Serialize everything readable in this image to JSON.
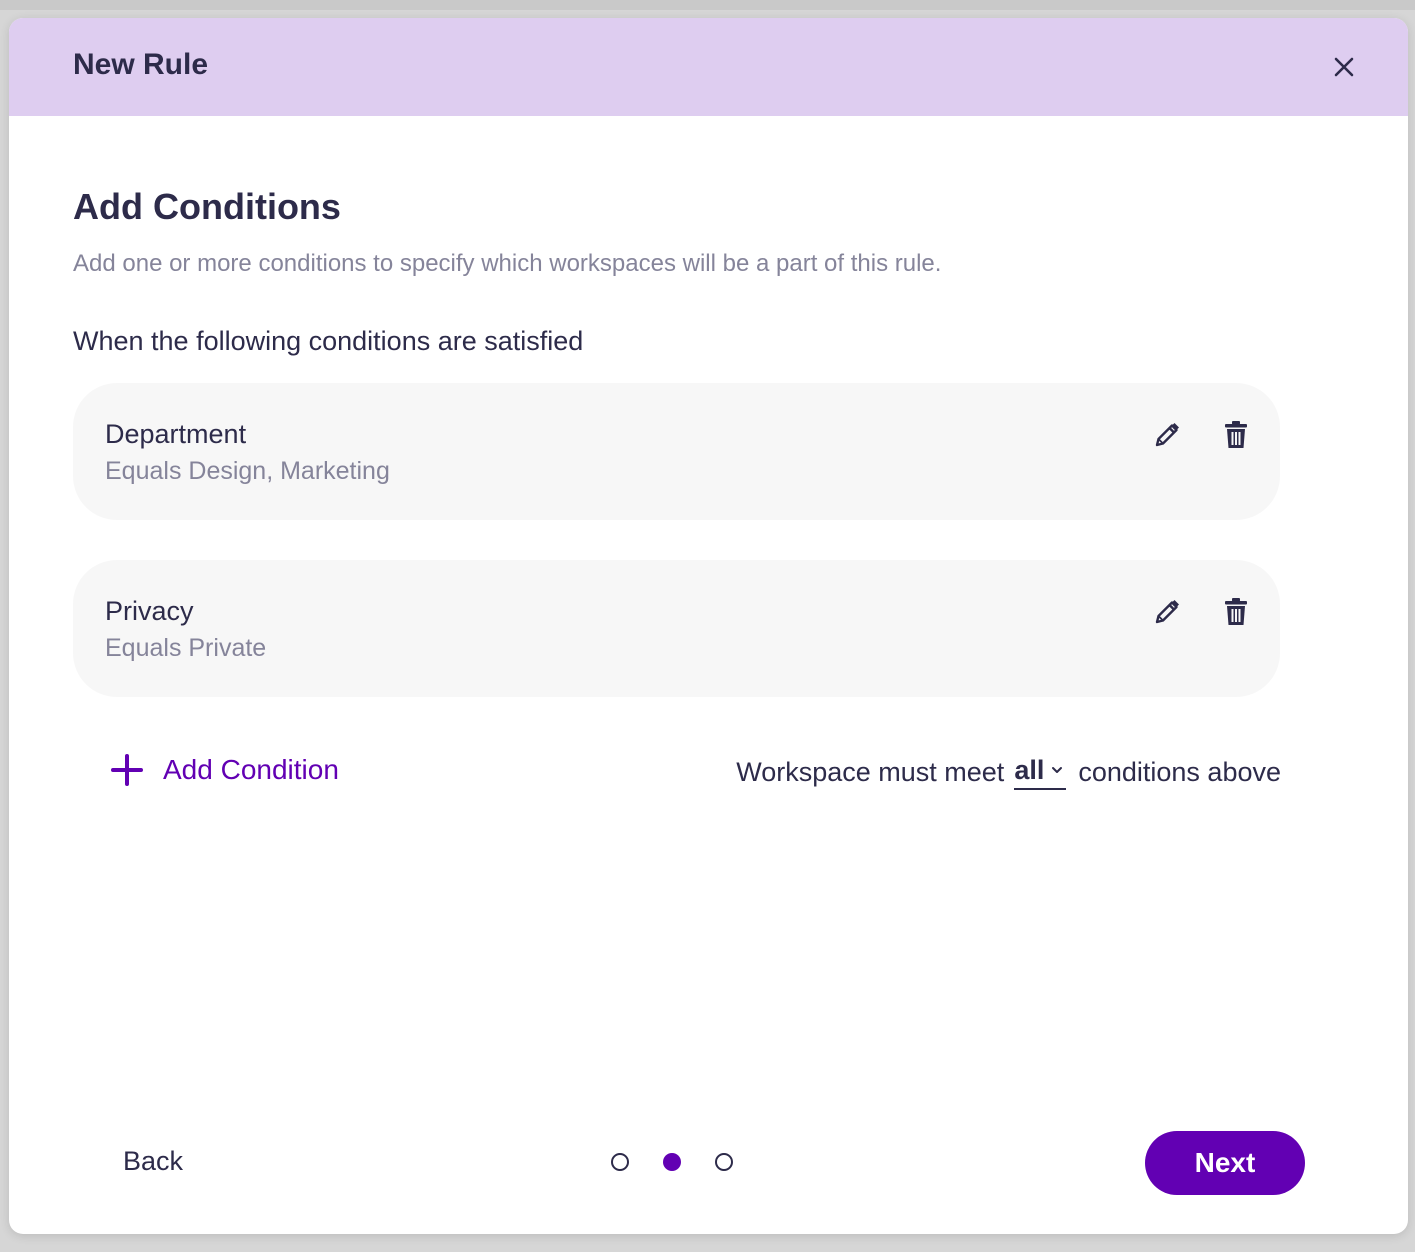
{
  "modal": {
    "title": "New Rule"
  },
  "section": {
    "title": "Add Conditions",
    "subtitle": "Add one or more conditions to specify which workspaces will be a part of this rule.",
    "conditions_label": "When the following conditions are satisfied"
  },
  "conditions": [
    {
      "name": "Department",
      "description": "Equals Design, Marketing"
    },
    {
      "name": "Privacy",
      "description": "Equals Private"
    }
  ],
  "actions": {
    "add_condition_label": "Add Condition"
  },
  "match": {
    "prefix": "Workspace must meet",
    "selected": "all",
    "suffix": "conditions above"
  },
  "footer": {
    "back_label": "Back",
    "next_label": "Next",
    "steps_total": 3,
    "current_step": 2
  },
  "colors": {
    "accent": "#6200b3",
    "header_bg": "#decdf0",
    "text_primary": "#2d2b4a",
    "text_secondary": "#85849a",
    "card_bg": "#f7f7f7"
  },
  "icons": [
    "close-icon",
    "pencil-icon",
    "trash-icon",
    "plus-icon",
    "chevron-down-icon"
  ]
}
